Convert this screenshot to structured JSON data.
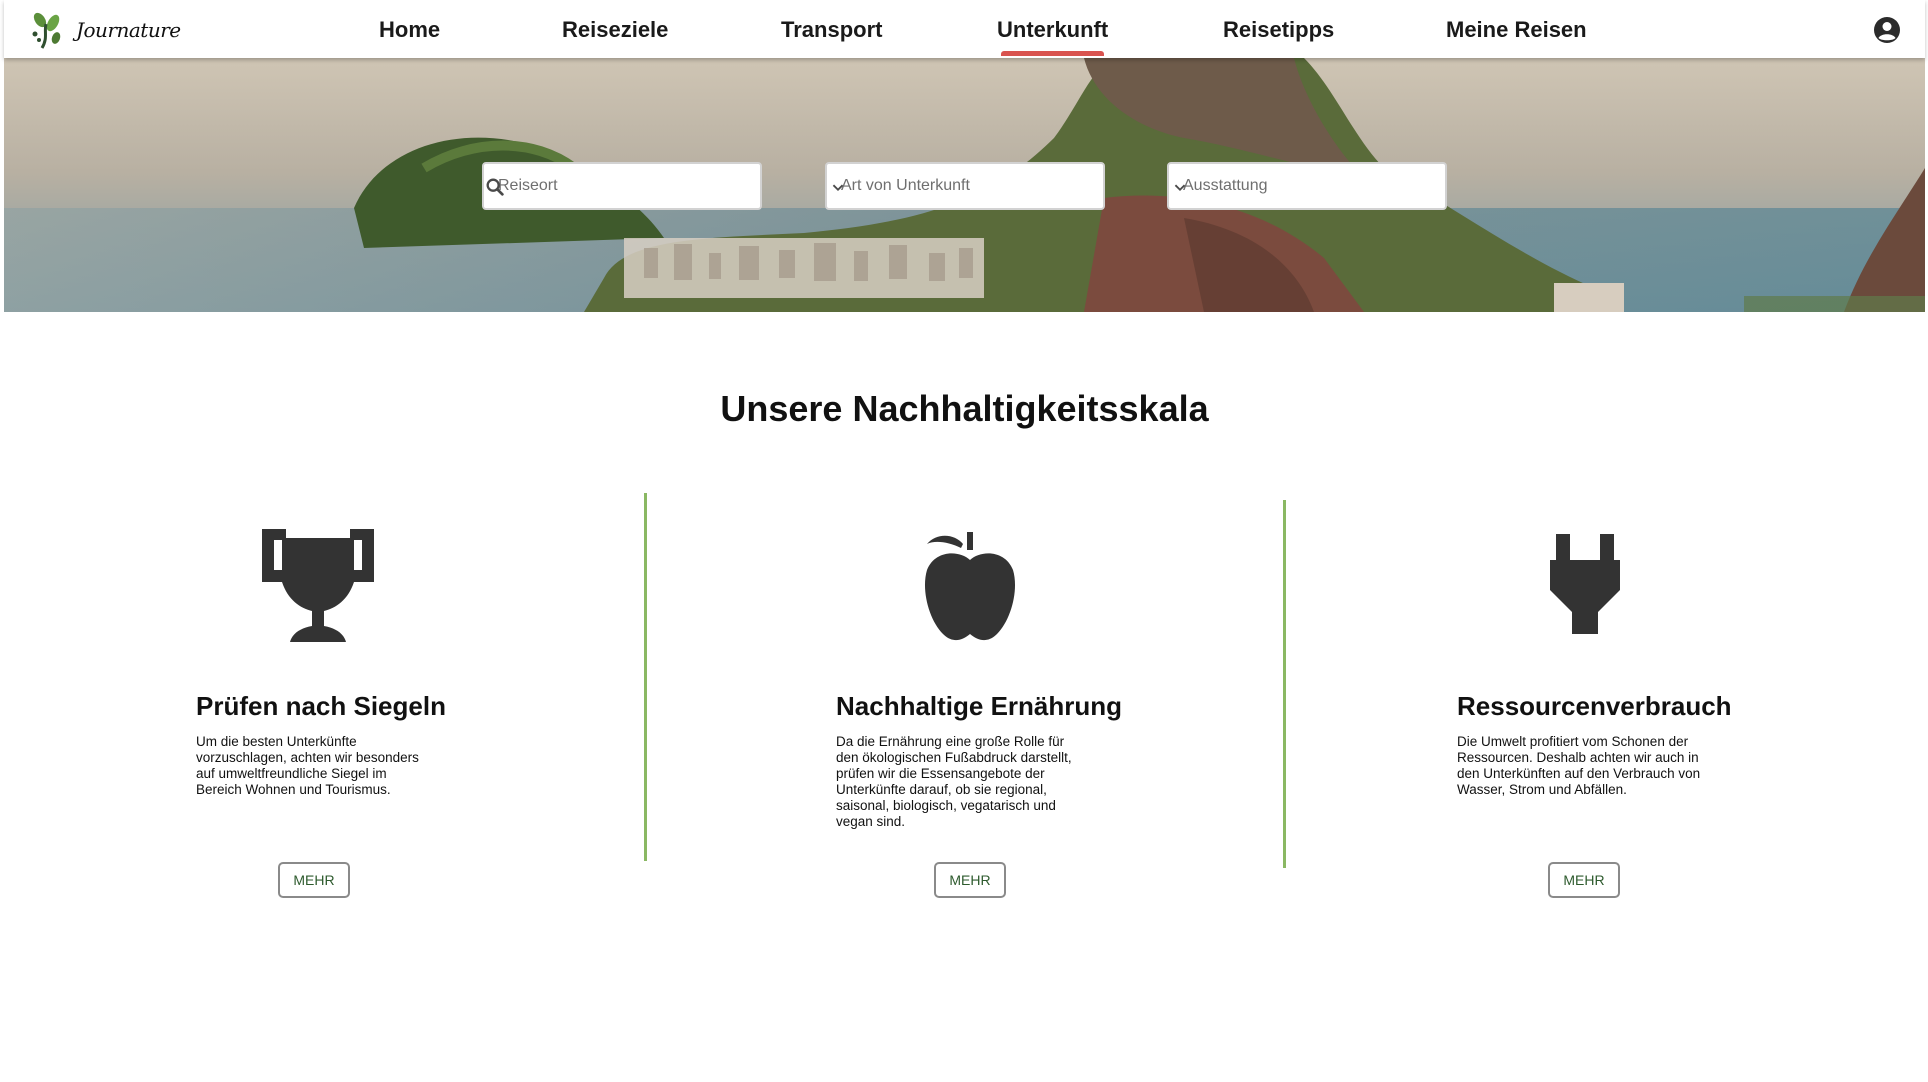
{
  "app": {
    "brand": "Journature"
  },
  "nav": {
    "items": [
      {
        "label": "Home"
      },
      {
        "label": "Reiseziele"
      },
      {
        "label": "Transport"
      },
      {
        "label": "Unterkunft"
      },
      {
        "label": "Reisetipps"
      },
      {
        "label": "Meine Reisen"
      }
    ],
    "active": "Unterkunft",
    "account_icon": "account-circle-icon"
  },
  "search": {
    "location_placeholder": "Reiseort",
    "accommodation_type_placeholder": "Art von Unterkunft",
    "amenities_placeholder": "Ausstattung"
  },
  "section": {
    "title": "Unsere Nachhaltigkeitsskala"
  },
  "features": [
    {
      "icon": "trophy-icon",
      "title": "Prüfen nach Siegeln",
      "lines": [
        "Um die besten Unterkünfte",
        "vorzuschlagen, achten wir besonders",
        "auf umweltfreundliche Siegel im",
        "Bereich Wohnen und Tourismus."
      ],
      "button": "MEHR"
    },
    {
      "icon": "apple-icon",
      "title": "Nachhaltige Ernährung",
      "lines": [
        "Da die Ernährung eine große Rolle für",
        "den ökologischen Fußabdruck darstellt,",
        "prüfen wir die Essensangebote der",
        "Unterkünfte darauf, ob sie regional,",
        "saisonal, biologisch, vegatarisch und",
        "vegan sind."
      ],
      "button": "MEHR"
    },
    {
      "icon": "plug-icon",
      "title": "Ressourcenverbrauch",
      "lines": [
        "Die Umwelt profitiert vom Schonen der",
        "Ressourcen. Deshalb achten wir auch in",
        "den Unterkünften auf den Verbrauch von",
        "Wasser, Strom und Abfällen."
      ],
      "button": "MEHR"
    }
  ],
  "colors": {
    "active_underline": "#d9534f",
    "divider": "#8ab863",
    "button_text": "#2d5a2d",
    "icon": "#333333"
  }
}
